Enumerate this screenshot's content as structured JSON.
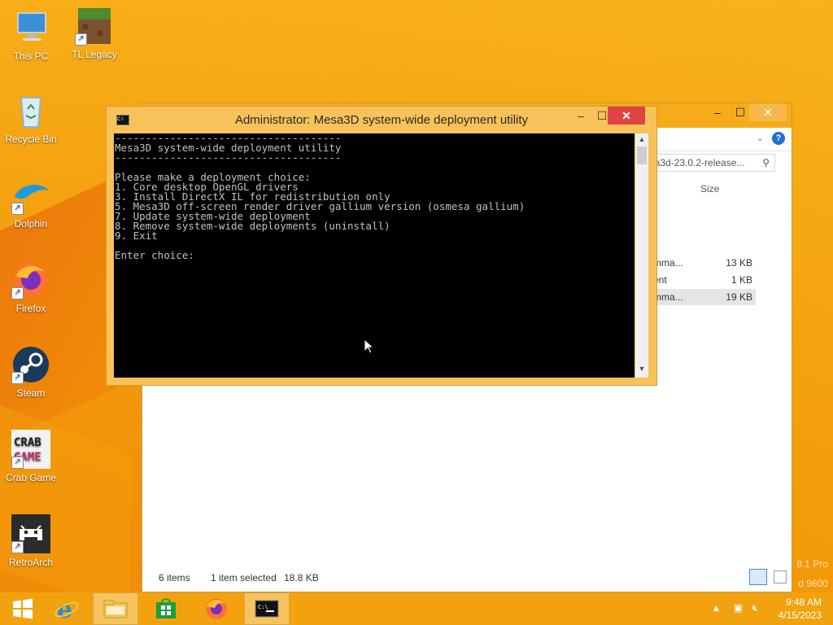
{
  "desktop": {
    "icons": [
      {
        "label": "This PC"
      },
      {
        "label": "TL Legacy"
      },
      {
        "label": "Recycle Bin"
      },
      {
        "label": "Dolphin"
      },
      {
        "label": "Firefox"
      },
      {
        "label": "Steam"
      },
      {
        "label": "Crab Game"
      },
      {
        "label": "RetroArch"
      }
    ],
    "watermark": {
      "line1": "8.1 Pro",
      "line2": "d 9600"
    }
  },
  "explorer": {
    "search_text": "esa3d-23.0.2-release...",
    "column_size": "Size",
    "rows": [
      {
        "name": "mma...",
        "size": "13 KB",
        "selected": false
      },
      {
        "name": "ent",
        "size": "1 KB",
        "selected": false
      },
      {
        "name": "mma...",
        "size": "19 KB",
        "selected": true
      }
    ],
    "status": {
      "items": "6 items",
      "selected": "1 item selected",
      "size": "18.8 KB"
    }
  },
  "console": {
    "title": "Administrator:  Mesa3D system-wide deployment utility",
    "icon_text": "C:\\",
    "lines": [
      "-------------------------------------",
      "Mesa3D system-wide deployment utility",
      "-------------------------------------",
      "Please make a deployment choice:",
      "1. Core desktop OpenGL drivers",
      "3. Install DirectX IL for redistribution only",
      "5. Mesa3D off-screen render driver gallium version (osmesa gallium)",
      "7. Update system-wide deployment",
      "8. Remove system-wide deployments (uninstall)",
      "9. Exit",
      "",
      "Enter choice:"
    ]
  },
  "taskbar": {
    "time": "9:48 AM",
    "date": "4/15/2023",
    "items": [
      "start",
      "internet-explorer",
      "file-explorer",
      "store",
      "firefox",
      "command-prompt"
    ]
  },
  "colors": {
    "accent": "#f7ab18",
    "close": "#e04343",
    "console_bg": "#000000",
    "console_fg": "#c0c0c0"
  }
}
